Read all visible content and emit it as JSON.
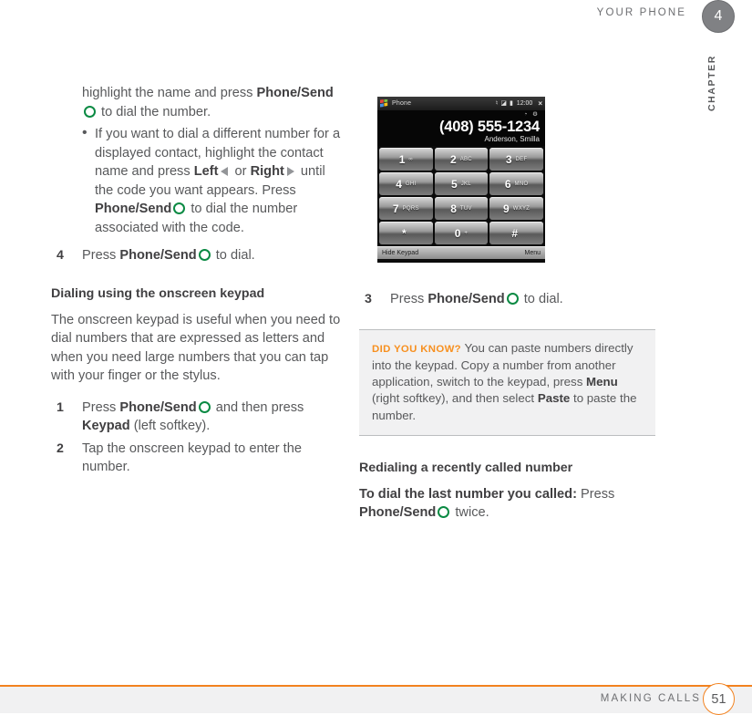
{
  "header": {
    "running_title": "YOUR PHONE",
    "chapter_number": "4",
    "chapter_label": "CHAPTER"
  },
  "footer": {
    "running_title": "MAKING CALLS",
    "page_number": "51",
    "rule_color": "#f2821f"
  },
  "colors": {
    "accent_orange": "#f2821f",
    "tip_label_orange": "#f79020",
    "send_key_green": "#0a8a43",
    "body_text": "#58595b",
    "heading_text": "#414042",
    "tip_bg": "#f1f1f2"
  },
  "left_column": {
    "continued_paragraph": {
      "prefix": "highlight the name and press ",
      "bold1": "Phone/",
      "bold2": "Send",
      "suffix": " to dial the number."
    },
    "bullet": {
      "part1": "If you want to dial a different number for a displayed contact, highlight the contact name and press ",
      "bold_left": "Left",
      "part2": " or ",
      "bold_right": "Right",
      "part3": " until the code you want appears. Press ",
      "bold_send": "Phone/Send",
      "part4": " to dial the number associated with the code."
    },
    "step4": {
      "num": "4",
      "prefix": "Press ",
      "bold": "Phone/Send",
      "suffix": " to dial."
    },
    "heading": "Dialing using the onscreen keypad",
    "intro": "The onscreen keypad is useful when you need to dial numbers that are expressed as letters and when you need large numbers that you can tap with your finger or the stylus.",
    "steps": [
      {
        "num": "1",
        "prefix": "Press ",
        "bold1": "Phone/Send",
        "mid": " and then press ",
        "bold2": "Keypad",
        "suffix": " (left softkey)."
      },
      {
        "num": "2",
        "prefix": "Tap the onscreen keypad to enter the number.",
        "bold1": "",
        "mid": "",
        "bold2": "",
        "suffix": ""
      }
    ]
  },
  "right_column": {
    "phone_screenshot": {
      "app_title": "Phone",
      "status_icons": [
        "volume-icon",
        "signal-icon",
        "battery-icon"
      ],
      "time": "12:00",
      "close_glyph": "×",
      "call_icons": "◔ ⚙",
      "dialed_number": "(408) 555-1234",
      "contact_name": "Anderson, Smilla",
      "keys": [
        {
          "digit": "1",
          "letters": "∞"
        },
        {
          "digit": "2",
          "letters": "ABC"
        },
        {
          "digit": "3",
          "letters": "DEF"
        },
        {
          "digit": "4",
          "letters": "GHI"
        },
        {
          "digit": "5",
          "letters": "JKL"
        },
        {
          "digit": "6",
          "letters": "MNO"
        },
        {
          "digit": "7",
          "letters": "PQRS"
        },
        {
          "digit": "8",
          "letters": "TUV"
        },
        {
          "digit": "9",
          "letters": "WXYZ"
        },
        {
          "digit": "*",
          "letters": ""
        },
        {
          "digit": "0",
          "letters": "+"
        },
        {
          "digit": "#",
          "letters": ""
        }
      ],
      "left_softkey": "Hide Keypad",
      "right_softkey": "Menu"
    },
    "step3": {
      "num": "3",
      "prefix": "Press ",
      "bold": "Phone/Send",
      "suffix": " to dial."
    },
    "tip": {
      "label": "DID YOU KNOW?",
      "part1": " You can paste numbers directly into the keypad. Copy a number from another application, switch to the keypad, press ",
      "bold1": "Menu",
      "part2": " (right softkey), and then select ",
      "bold2": "Paste",
      "part3": " to paste the number."
    },
    "heading": "Redialing a recently called number",
    "redial": {
      "bold_lead": "To dial the last number you called:",
      "part1": " Press ",
      "bold_send": "Phone/Send",
      "part2": " twice."
    }
  }
}
